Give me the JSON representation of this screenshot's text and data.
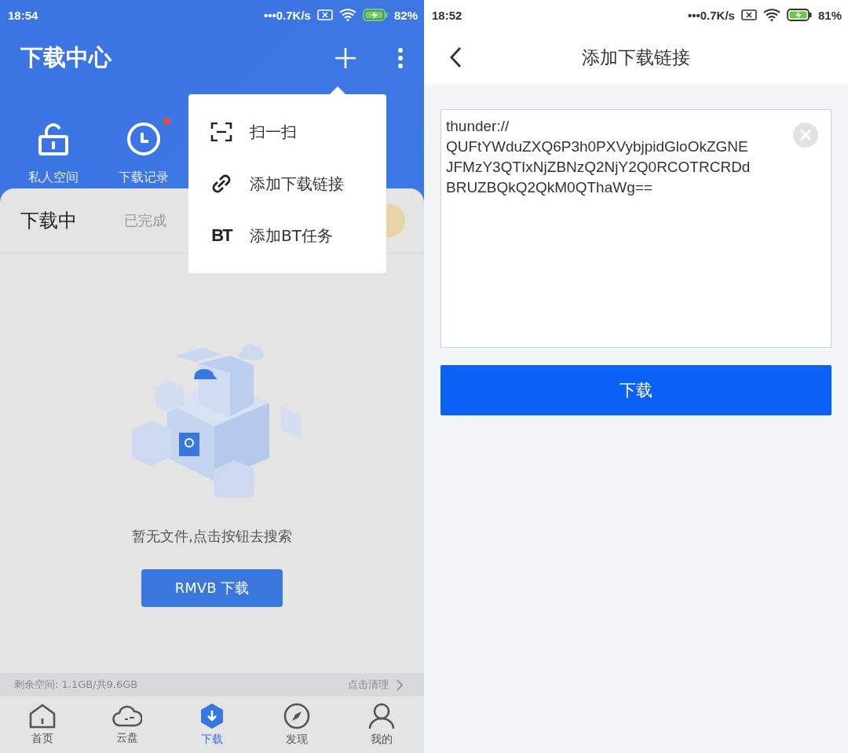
{
  "left_screen": {
    "status_bar": {
      "time": "18:54",
      "speed": "•••0.7K/s",
      "battery": "82%"
    },
    "title": "下载中心",
    "shortcuts": [
      {
        "kind": "lock",
        "label": "私人空间",
        "badge": false
      },
      {
        "kind": "clock",
        "label": "下载记录",
        "badge": true
      }
    ],
    "tabs": [
      {
        "label": "下载中",
        "selected": true
      },
      {
        "label": "已完成",
        "selected": false
      }
    ],
    "empty_message": "暂无文件,点击按钮去搜索",
    "search_button": "RMVB 下载",
    "storage": {
      "text": "剩余空间: 1.1GB/共9.6GB",
      "action": "点击清理"
    },
    "nav": [
      {
        "kind": "home",
        "label": "首页",
        "selected": false
      },
      {
        "kind": "cloud",
        "label": "云盘",
        "selected": false
      },
      {
        "kind": "download",
        "label": "下载",
        "selected": true
      },
      {
        "kind": "compass",
        "label": "发现",
        "selected": false
      },
      {
        "kind": "person",
        "label": "我的",
        "selected": false
      }
    ],
    "menu": [
      {
        "kind": "scan",
        "label": "扫一扫"
      },
      {
        "kind": "link",
        "label": "添加下载链接"
      },
      {
        "kind": "text",
        "icon": "BT",
        "label": "添加BT任务"
      }
    ]
  },
  "right_screen": {
    "status_bar": {
      "time": "18:52",
      "speed": "•••0.7K/s",
      "battery": "81%"
    },
    "title": "添加下载链接",
    "link_value": "thunder://\nQUFtYWduZXQ6P3h0PXVybjpidGloOkZGNE\nJFMzY3QTIxNjZBNzQ2NjY2Q0RCOTRCRDd\nBRUZBQkQ2QkM0QThaWg==",
    "download_button": "下载"
  }
}
